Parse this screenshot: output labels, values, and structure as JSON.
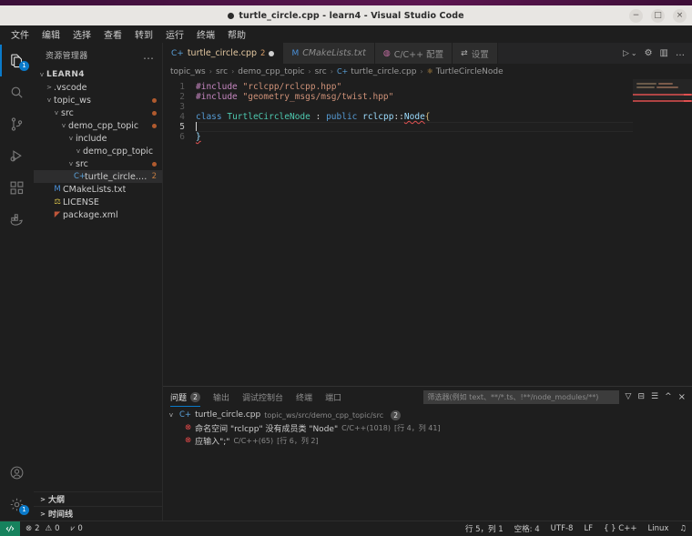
{
  "window": {
    "title": "turtle_circle.cpp - learn4 - Visual Studio Code",
    "dirty_indicator": "●",
    "controls": {
      "minimize": "−",
      "maximize": "□",
      "close": "×"
    }
  },
  "menubar": {
    "items": [
      {
        "label": "文件",
        "name": "menu-file"
      },
      {
        "label": "编辑",
        "name": "menu-edit"
      },
      {
        "label": "选择",
        "name": "menu-selection"
      },
      {
        "label": "查看",
        "name": "menu-view"
      },
      {
        "label": "转到",
        "name": "menu-go"
      },
      {
        "label": "运行",
        "name": "menu-run"
      },
      {
        "label": "终端",
        "name": "menu-terminal"
      },
      {
        "label": "帮助",
        "name": "menu-help"
      }
    ]
  },
  "activitybar": {
    "items": [
      {
        "icon": "files-explorer-icon",
        "badge": "1",
        "active": true
      },
      {
        "icon": "search-icon",
        "badge": "",
        "active": false
      },
      {
        "icon": "source-control-icon",
        "badge": "",
        "active": false
      },
      {
        "icon": "run-and-debug-icon",
        "badge": "",
        "active": false
      },
      {
        "icon": "extensions-icon",
        "badge": "",
        "active": false
      },
      {
        "icon": "docker-icon",
        "badge": "",
        "active": false
      }
    ],
    "bottom": [
      {
        "icon": "account-icon",
        "badge": ""
      },
      {
        "icon": "manage-gear-icon",
        "badge": "1"
      }
    ]
  },
  "sidebar": {
    "header_title": "资源管理器",
    "more_actions": "…",
    "tree": [
      {
        "label": "LEARN4",
        "depth": 0,
        "chev": "v",
        "icon": "",
        "icon_color": "",
        "root": true,
        "marker": "",
        "count": "",
        "selected": false
      },
      {
        "label": ".vscode",
        "depth": 1,
        "chev": ">",
        "icon": "",
        "icon_color": "",
        "root": false,
        "marker": "",
        "count": "",
        "selected": false
      },
      {
        "label": "topic_ws",
        "depth": 1,
        "chev": "v",
        "icon": "",
        "icon_color": "",
        "root": false,
        "marker": "●",
        "count": "",
        "selected": false
      },
      {
        "label": "src",
        "depth": 2,
        "chev": "v",
        "icon": "",
        "icon_color": "",
        "root": false,
        "marker": "●",
        "count": "",
        "selected": false
      },
      {
        "label": "demo_cpp_topic",
        "depth": 3,
        "chev": "v",
        "icon": "",
        "icon_color": "",
        "root": false,
        "marker": "●",
        "count": "",
        "selected": false
      },
      {
        "label": "include",
        "depth": 4,
        "chev": "v",
        "icon": "",
        "icon_color": "",
        "root": false,
        "marker": "",
        "count": "",
        "selected": false
      },
      {
        "label": "demo_cpp_topic",
        "depth": 5,
        "chev": "v",
        "icon": "",
        "icon_color": "",
        "root": false,
        "marker": "",
        "count": "",
        "selected": false
      },
      {
        "label": "src",
        "depth": 4,
        "chev": "v",
        "icon": "",
        "icon_color": "",
        "root": false,
        "marker": "●",
        "count": "",
        "selected": false
      },
      {
        "label": "turtle_circle.cpp",
        "depth": 5,
        "chev": "",
        "icon": "C+",
        "icon_color": "#5aa0d8",
        "root": false,
        "marker": "",
        "count": "2",
        "selected": true
      },
      {
        "label": "CMakeLists.txt",
        "depth": 2,
        "chev": "",
        "icon": "M",
        "icon_color": "#4a90d9",
        "root": false,
        "marker": "",
        "count": "",
        "selected": false
      },
      {
        "label": "LICENSE",
        "depth": 2,
        "chev": "",
        "icon": "⚖",
        "icon_color": "#d8c24a",
        "root": false,
        "marker": "",
        "count": "",
        "selected": false
      },
      {
        "label": "package.xml",
        "depth": 2,
        "chev": "",
        "icon": "◤",
        "icon_color": "#c0563a",
        "root": false,
        "marker": "",
        "count": "",
        "selected": false
      }
    ],
    "collapsed_panels": [
      {
        "label": "大纲",
        "chev": ">"
      },
      {
        "label": "时间线",
        "chev": ">"
      }
    ]
  },
  "editor": {
    "tabs": [
      {
        "label": "turtle_circle.cpp",
        "icon": "C+",
        "icon_color": "#5aa0d8",
        "count": "2",
        "dirty": true,
        "italic": false,
        "active": true
      },
      {
        "label": "CMakeLists.txt",
        "icon": "M",
        "icon_color": "#4a90d9",
        "count": "",
        "dirty": false,
        "italic": true,
        "active": false
      },
      {
        "label": "C/C++ 配置",
        "icon": "◍",
        "icon_color": "#c06ba0",
        "count": "",
        "dirty": false,
        "italic": false,
        "active": false
      },
      {
        "label": "设置",
        "icon": "⇄",
        "icon_color": "#b0b0b0",
        "count": "",
        "dirty": false,
        "italic": false,
        "active": false
      }
    ],
    "tab_actions": [
      {
        "icon": "run-code-icon",
        "label": "▷"
      },
      {
        "icon": "chevron-down-icon",
        "label": "⌄"
      },
      {
        "icon": "gear-icon",
        "label": "⚙"
      },
      {
        "icon": "split-editor-icon",
        "label": "▥"
      },
      {
        "icon": "more-actions-icon",
        "label": "…"
      }
    ],
    "breadcrumbs": [
      {
        "label": "topic_ws",
        "icon": ""
      },
      {
        "label": "src",
        "icon": ""
      },
      {
        "label": "demo_cpp_topic",
        "icon": ""
      },
      {
        "label": "src",
        "icon": ""
      },
      {
        "label": "turtle_circle.cpp",
        "icon": "C+"
      },
      {
        "label": "TurtleCircleNode",
        "icon": "⚛"
      }
    ],
    "breadcrumb_separator": "›",
    "line_numbers": [
      "1",
      "2",
      "3",
      "4",
      "5",
      "6"
    ],
    "current_line": 5,
    "code": {
      "line1_include": "#include",
      "line1_path": "\"rclcpp/rclcpp.hpp\"",
      "line2_include": "#include",
      "line2_path": "\"geometry_msgs/msg/twist.hpp\"",
      "line4_class": "class",
      "line4_typename": "TurtleCircleNode",
      "line4_colon": ":",
      "line4_public": "public",
      "line4_ns": "rclcpp",
      "line4_scope": "::",
      "line4_base": "Node",
      "line4_brace": "{",
      "line6_brace": "}"
    }
  },
  "panel": {
    "tabs": [
      {
        "label": "问题",
        "badge": "2",
        "active": true
      },
      {
        "label": "输出",
        "badge": "",
        "active": false
      },
      {
        "label": "调试控制台",
        "badge": "",
        "active": false
      },
      {
        "label": "终端",
        "badge": "",
        "active": false
      },
      {
        "label": "端口",
        "badge": "",
        "active": false
      }
    ],
    "filter": {
      "value": "",
      "placeholder": "筛选器(例如 text、**/*.ts、!**/node_modules/**)"
    },
    "actions": [
      {
        "icon": "filter-icon",
        "label": "▽"
      },
      {
        "icon": "collapse-all-icon",
        "label": "⊟"
      },
      {
        "icon": "view-as-list-icon",
        "label": "☰"
      },
      {
        "icon": "chevron-up-icon",
        "label": "^"
      },
      {
        "icon": "close-panel-icon",
        "label": "×"
      }
    ],
    "problems": {
      "file": {
        "chev": "v",
        "icon": "C+",
        "name": "turtle_circle.cpp",
        "path": "topic_ws/src/demo_cpp_topic/src",
        "count": "2"
      },
      "rows": [
        {
          "icon": "error-icon",
          "message": "命名空间 \"rclcpp\" 没有成员类 \"Node\"",
          "source": "C/C++(1018)",
          "location": "[行 4，列 41]"
        },
        {
          "icon": "error-icon",
          "message": "应输入\";\"",
          "source": "C/C++(65)",
          "location": "[行 6，列 2]"
        }
      ]
    }
  },
  "statusbar": {
    "remote_icon": "remote-window-icon",
    "remote_label": "",
    "problems": {
      "errors_icon": "error-circle-icon",
      "errors": "2",
      "warnings_icon": "warning-triangle-icon",
      "warnings": "0"
    },
    "radio": {
      "icon": "radio-tower-icon",
      "value": "0"
    },
    "right": [
      {
        "label": "行 5，列 1",
        "name": "editor-position"
      },
      {
        "label": "空格: 4",
        "name": "indentation"
      },
      {
        "label": "UTF-8",
        "name": "encoding"
      },
      {
        "label": "LF",
        "name": "eol"
      },
      {
        "label": "{ } C++",
        "name": "language-mode"
      },
      {
        "label": "Linux",
        "name": "platform"
      },
      {
        "label": "♫",
        "name": "notifications-bell"
      }
    ]
  },
  "colors": {
    "accent": "#0a7aca",
    "error": "#f14c4c",
    "titlebar_bg": "#e8e6e3",
    "editor_bg": "#1e1e1e",
    "modified": "#b05a2e"
  }
}
